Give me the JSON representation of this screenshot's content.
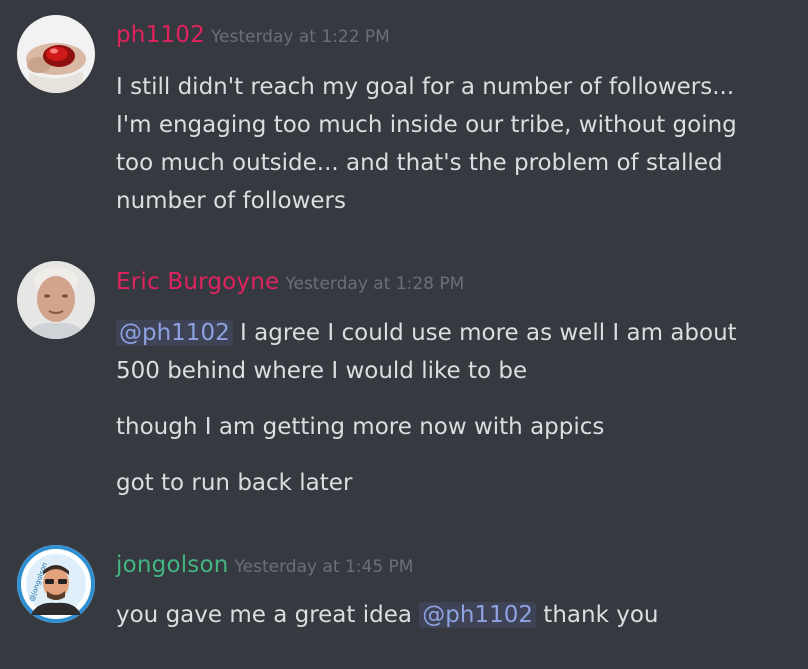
{
  "colors": {
    "background": "#36393f",
    "text": "#dcddde",
    "timestamp": "#6c6f76",
    "mention_text": "#8ea1e1"
  },
  "messages": [
    {
      "author": "ph1102",
      "author_color": "#e0225f",
      "timestamp": "Yesterday at 1:22 PM",
      "avatar_icon": "ph1102-avatar-red-gem",
      "lines": [
        "I still didn't reach my goal for a number of followers...",
        "I'm engaging too much inside our tribe, without going",
        "too much outside... and that's the problem of stalled",
        "number of followers"
      ]
    },
    {
      "author": "Eric Burgoyne",
      "author_color": "#e0225f",
      "timestamp": "Yesterday at 1:28 PM",
      "avatar_icon": "eric-burgoyne-avatar-photo",
      "mention": "@ph1102",
      "line1_rest": " I agree I could use more as well I am about",
      "line2": "500 behind where I would like to be",
      "line3": "though I am getting more now with appics",
      "line4": "got to run back later"
    },
    {
      "author": "jongolson",
      "author_color": "#43b581",
      "timestamp": "Yesterday at 1:45 PM",
      "avatar_icon": "jongolson-avatar-cartoon",
      "avatar_ring_text": "@jongolson",
      "text_before": "you gave me a great idea ",
      "mention": "@ph1102",
      "text_after": " thank you"
    }
  ]
}
